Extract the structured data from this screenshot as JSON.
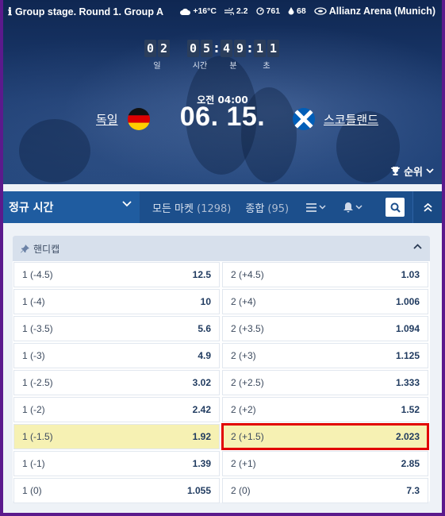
{
  "match_info": {
    "stage": "Group stage. Round 1. Group A",
    "temperature": "+16°C",
    "wind": "2.2",
    "pressure": "761",
    "humidity": "68",
    "venue": "Allianz Arena (Munich)"
  },
  "countdown": {
    "days": [
      "0",
      "2"
    ],
    "hours": [
      "0",
      "5"
    ],
    "minutes": [
      "4",
      "9"
    ],
    "seconds": [
      "1",
      "1"
    ],
    "days_label": "일",
    "hours_label": "시간",
    "minutes_label": "분",
    "seconds_label": "초"
  },
  "match": {
    "kickoff": "오전 04:00",
    "date": "06. 15.",
    "home": "독일",
    "away": "스코틀랜드"
  },
  "standings_label": "순위",
  "tabs": {
    "period": "정규 시간",
    "all_markets": "모든 마켓",
    "all_markets_count": "(1298)",
    "combo": "종합",
    "combo_count": "(95)"
  },
  "market": {
    "title": "핸디캡",
    "rows": [
      {
        "left_label": "1 (-4.5)",
        "left_odd": "12.5",
        "right_label": "2 (+4.5)",
        "right_odd": "1.03"
      },
      {
        "left_label": "1 (-4)",
        "left_odd": "10",
        "right_label": "2 (+4)",
        "right_odd": "1.006"
      },
      {
        "left_label": "1 (-3.5)",
        "left_odd": "5.6",
        "right_label": "2 (+3.5)",
        "right_odd": "1.094"
      },
      {
        "left_label": "1 (-3)",
        "left_odd": "4.9",
        "right_label": "2 (+3)",
        "right_odd": "1.125"
      },
      {
        "left_label": "1 (-2.5)",
        "left_odd": "3.02",
        "right_label": "2 (+2.5)",
        "right_odd": "1.333"
      },
      {
        "left_label": "1 (-2)",
        "left_odd": "2.42",
        "right_label": "2 (+2)",
        "right_odd": "1.52"
      },
      {
        "left_label": "1 (-1.5)",
        "left_odd": "1.92",
        "right_label": "2 (+1.5)",
        "right_odd": "2.023"
      },
      {
        "left_label": "1 (-1)",
        "left_odd": "1.39",
        "right_label": "2 (+1)",
        "right_odd": "2.85"
      },
      {
        "left_label": "1 (0)",
        "left_odd": "1.055",
        "right_label": "2 (0)",
        "right_odd": "7.3"
      }
    ]
  },
  "colors": {
    "accent": "#1c4f8c",
    "selected": "#f6f1b3",
    "highlight_outline": "#e10000"
  }
}
